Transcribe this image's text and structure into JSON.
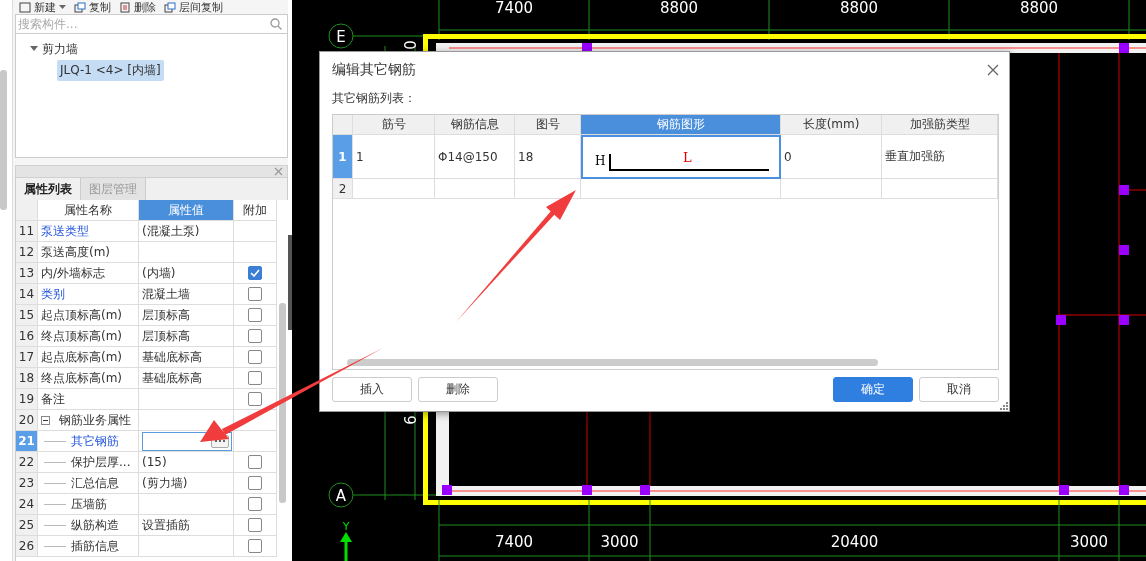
{
  "toolbar": [
    {
      "label": "新建",
      "has_menu": true
    },
    {
      "label": "复制",
      "has_menu": false
    },
    {
      "label": "删除",
      "has_menu": false
    },
    {
      "label": "层间复制",
      "has_menu": false
    }
  ],
  "search": {
    "placeholder": "搜索构件..."
  },
  "tree": [
    {
      "label": "剪力墙",
      "expanded": true,
      "children": [
        {
          "label": "JLQ-1 <4> [内墙]",
          "selected": true
        }
      ]
    }
  ],
  "panel_tabs": [
    {
      "label": "属性列表",
      "selected": true
    },
    {
      "label": "图层管理",
      "selected": false
    }
  ],
  "property_table": {
    "columns": [
      {
        "label": "属性名称",
        "selected": false
      },
      {
        "label": "属性值",
        "selected": true
      },
      {
        "label": "附加",
        "selected": false
      }
    ],
    "rows": [
      {
        "number": "11",
        "name": "泵送类型",
        "value": "(混凝土泵)",
        "link": true,
        "selected": false
      },
      {
        "number": "12",
        "name": "泵送高度(m)",
        "link": false,
        "selected": false
      },
      {
        "number": "13",
        "name": "内/外墙标志",
        "value": "(内墙)",
        "link": false,
        "selected": false,
        "checked": true
      },
      {
        "number": "14",
        "name": "类别",
        "value": "混凝土墙",
        "link": true,
        "selected": false,
        "checked": false
      },
      {
        "number": "15",
        "name": "起点顶标高(m)",
        "value": "层顶标高",
        "link": false,
        "selected": false,
        "checked": false
      },
      {
        "number": "16",
        "name": "终点顶标高(m)",
        "value": "层顶标高",
        "link": false,
        "selected": false,
        "checked": false
      },
      {
        "number": "17",
        "name": "起点底标高(m)",
        "value": "基础底标高",
        "link": false,
        "selected": false,
        "checked": false
      },
      {
        "number": "18",
        "name": "终点底标高(m)",
        "value": "基础底标高",
        "link": false,
        "selected": false,
        "checked": false
      },
      {
        "number": "19",
        "name": "备注",
        "link": false,
        "selected": false,
        "checked": false
      },
      {
        "number": "20",
        "name": "钢筋业务属性",
        "link": false,
        "selected": false,
        "expanded": true,
        "children": [
          {
            "number": "21",
            "name": "其它钢筋",
            "link": true,
            "selected": true
          },
          {
            "number": "22",
            "name": "保护层厚...",
            "value": "(15)",
            "link": false,
            "selected": false,
            "checked": false
          },
          {
            "number": "23",
            "name": "汇总信息",
            "value": "(剪力墙)",
            "link": false,
            "selected": false,
            "checked": false
          },
          {
            "number": "24",
            "name": "压墙筋",
            "link": false,
            "selected": false,
            "checked": false
          },
          {
            "number": "25",
            "name": "纵筋构造",
            "value": "设置插筋",
            "link": false,
            "selected": false,
            "checked": false
          },
          {
            "number": "26",
            "name": "插筋信息",
            "link": false,
            "selected": false,
            "checked": false
          }
        ]
      }
    ]
  },
  "dialog": {
    "title": "编辑其它钢筋",
    "list_label": "其它钢筋列表：",
    "columns": [
      {
        "label": "筋号",
        "selected": false
      },
      {
        "label": "钢筋信息",
        "selected": false
      },
      {
        "label": "图号",
        "selected": false
      },
      {
        "label": "钢筋图形",
        "selected": true
      },
      {
        "label": "长度(mm)",
        "selected": false
      },
      {
        "label": "加强筋类型",
        "selected": false
      }
    ],
    "rows": [
      {
        "number": "1",
        "selected": true,
        "bar_no": "1",
        "info": "Φ14@150",
        "figure_no": "18",
        "shape": {
          "h": "H",
          "l": "L"
        },
        "length": "0",
        "type": "垂直加强筋"
      },
      {
        "number": "2",
        "selected": false
      }
    ],
    "buttons": [
      {
        "label": "插入",
        "primary": false
      },
      {
        "label": "删除",
        "primary": false
      },
      {
        "label": "确定",
        "primary": true
      },
      {
        "label": "取消",
        "primary": false
      }
    ]
  },
  "cad": {
    "top_dims": [
      "7400",
      "8800",
      "8800",
      "8800"
    ],
    "bottom_dims": [
      "7400",
      "3000",
      "20400",
      "3000"
    ],
    "axes": [
      "E",
      "A"
    ],
    "side_dims": [
      "0",
      "9"
    ],
    "ucs_label": "Y"
  }
}
